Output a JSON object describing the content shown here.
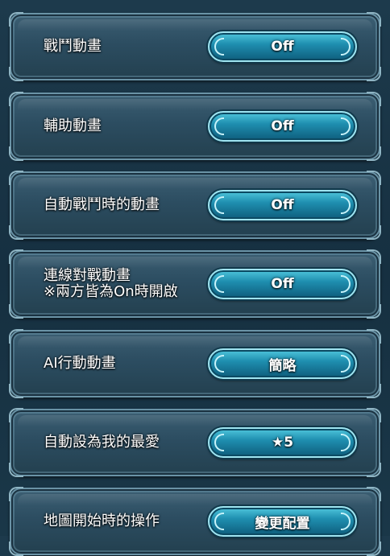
{
  "settings": [
    {
      "label": "戰鬥動畫",
      "value": "Off"
    },
    {
      "label": "輔助動畫",
      "value": "Off"
    },
    {
      "label": "自動戰鬥時的動畫",
      "value": "Off"
    },
    {
      "label": "連線對戰動畫\n※兩方皆為On時開啟",
      "value": "Off"
    },
    {
      "label": "AI行動動畫",
      "value": "簡略"
    },
    {
      "label": "自動設為我的最愛",
      "value": "★5"
    },
    {
      "label": "地圖開始時的操作",
      "value": "變更配置"
    }
  ]
}
